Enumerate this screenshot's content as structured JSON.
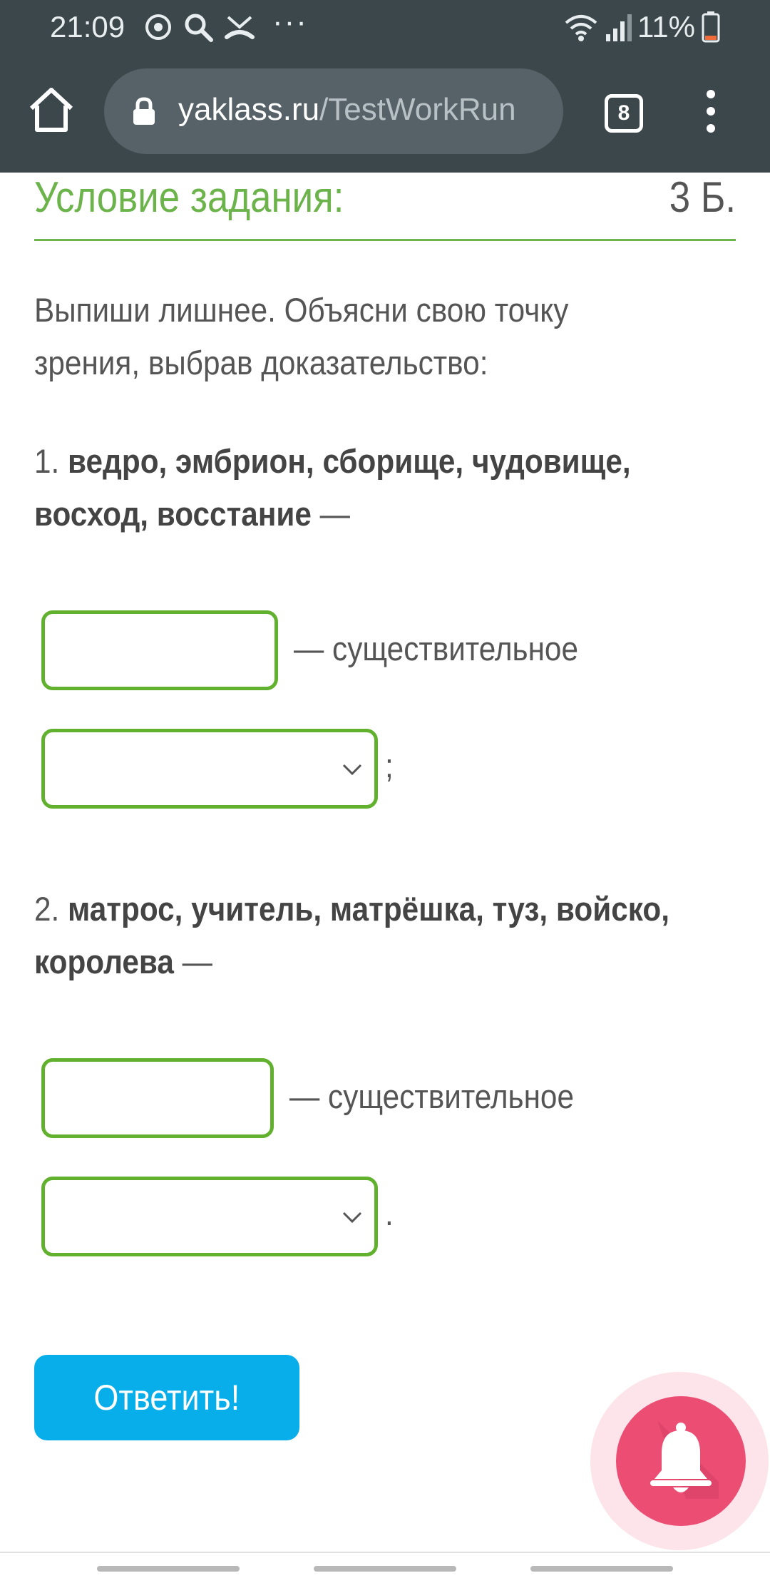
{
  "status_bar": {
    "time": "21:09",
    "battery": "11%",
    "overflow": "···",
    "icons": [
      "sync-icon",
      "search-icon",
      "missed-call-icon",
      "wifi-icon",
      "signal-icon",
      "battery-icon"
    ]
  },
  "browser": {
    "url_host": "yaklass.ru",
    "url_path": "/TestWorkRun",
    "tab_count": "8",
    "icons": [
      "home-icon",
      "lock-icon",
      "menu-icon"
    ]
  },
  "task": {
    "title": "Условие задания:",
    "points": "3 Б.",
    "instruction_line1": "Выпиши лишнее. Объясни свою точку",
    "instruction_line2": "зрения, выбрав доказательство:",
    "q1": {
      "number": "1.",
      "words_line1": "ведро, эмбрион, сборище, чудовище,",
      "words_line2": "восход, восстание",
      "dash": " —",
      "input_value": "",
      "suffix": "— существительное",
      "select_value": "",
      "select_end": ";"
    },
    "q2": {
      "number": "2.",
      "words_line1": "матрос, учитель, матрёшка, туз, войско,",
      "words_line2": "королева",
      "dash": " —",
      "input_value": "",
      "suffix": "— существительное",
      "select_value": "",
      "select_end": "."
    },
    "submit_label": "Ответить!"
  },
  "colors": {
    "accent_green": "#61b02e",
    "submit_blue": "#08aeea",
    "bell_pink": "#ec4d73",
    "browser_bar": "#3c474c"
  }
}
